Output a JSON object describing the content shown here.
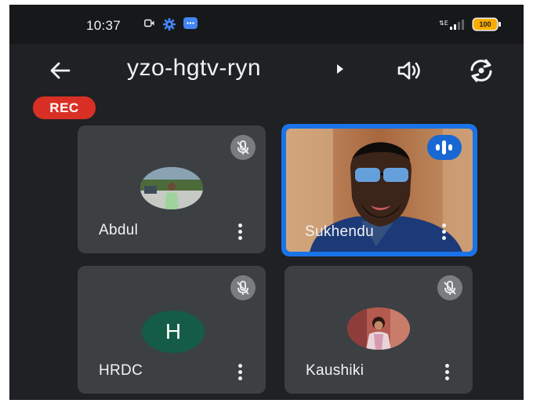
{
  "status_bar": {
    "time": "10:37",
    "battery": "100",
    "icons": [
      "video-camera-icon",
      "gear-icon",
      "chat-bubble-icon",
      "signal-icon",
      "battery-icon"
    ]
  },
  "app_bar": {
    "meeting_code": "yzo-hgtv-ryn",
    "icons": [
      "back-arrow-icon",
      "caret-right-icon",
      "speaker-icon",
      "switch-camera-icon"
    ]
  },
  "rec_badge": "REC",
  "participants": [
    {
      "name": "Abdul",
      "muted": true,
      "avatar": "photo"
    },
    {
      "name": "Sukhendu",
      "muted": false,
      "speaking": true,
      "avatar": "video"
    },
    {
      "name": "HRDC",
      "muted": true,
      "avatar_letter": "H"
    },
    {
      "name": "Kaushiki",
      "muted": true,
      "avatar": "photo"
    }
  ],
  "colors": {
    "background": "#202124",
    "tile": "#3c4043",
    "active_speaker_border": "#1a73e8",
    "rec": "#d93025",
    "hrdc_avatar": "#145c45"
  }
}
